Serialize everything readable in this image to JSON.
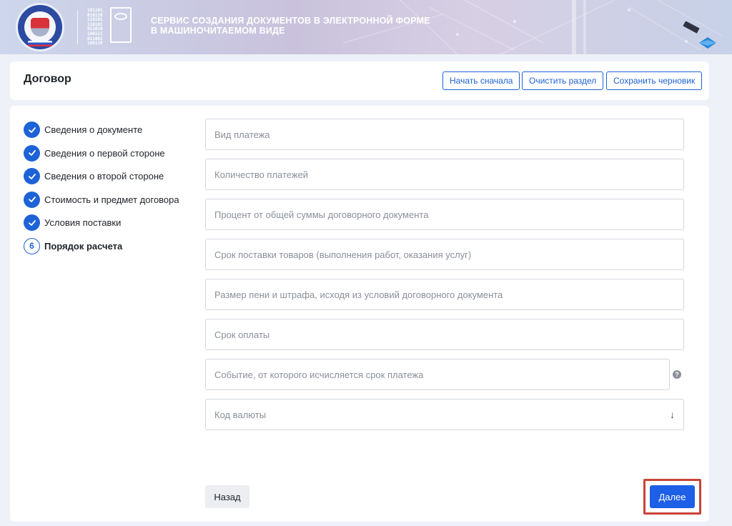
{
  "header": {
    "title_line1": "СЕРВИС СОЗДАНИЯ ДОКУМЕНТОВ В ЭЛЕКТРОННОЙ ФОРМЕ",
    "title_line2": "В МАШИНОЧИТАЕМОМ ВИДЕ",
    "logo_icon": "fns-emblem-icon",
    "service_icon": "machine-readable-document-icon",
    "binary_text": "101101\n010110\n110101\n110101\n011010\n100111\n011001\n100110"
  },
  "page": {
    "title": "Договор",
    "buttons": {
      "start_over": "Начать сначала",
      "clear_section": "Очистить раздел",
      "save_draft": "Сохранить черновик"
    }
  },
  "steps": [
    {
      "label": "Сведения о документе",
      "status": "done"
    },
    {
      "label": "Сведения о первой стороне",
      "status": "done"
    },
    {
      "label": "Сведения о второй стороне",
      "status": "done"
    },
    {
      "label": "Стоимость и предмет договора",
      "status": "done"
    },
    {
      "label": "Условия поставки",
      "status": "done"
    },
    {
      "label": "Порядок расчета",
      "status": "current",
      "number": "6"
    }
  ],
  "form": {
    "payment_type": {
      "placeholder": "Вид платежа",
      "value": ""
    },
    "payment_count": {
      "placeholder": "Количество платежей",
      "value": ""
    },
    "percent_of_total": {
      "placeholder": "Процент от общей суммы договорного документа",
      "value": ""
    },
    "delivery_term": {
      "placeholder": "Срок поставки товаров (выполнения работ, оказания услуг)",
      "value": ""
    },
    "penalty_amount": {
      "placeholder": "Размер пени и штрафа, исходя из условий договорного документа",
      "value": ""
    },
    "payment_term": {
      "placeholder": "Срок оплаты",
      "value": ""
    },
    "payment_event": {
      "placeholder": "Событие, от которого исчисляется срок платежа",
      "value": ""
    },
    "help_glyph": "?",
    "currency_code": {
      "placeholder": "Код валюты",
      "arrow": "↓"
    }
  },
  "nav": {
    "back": "Назад",
    "next": "Далее"
  },
  "colors": {
    "accent": "#1d62d7",
    "highlight": "#c9433a",
    "background": "#eef1f7"
  }
}
